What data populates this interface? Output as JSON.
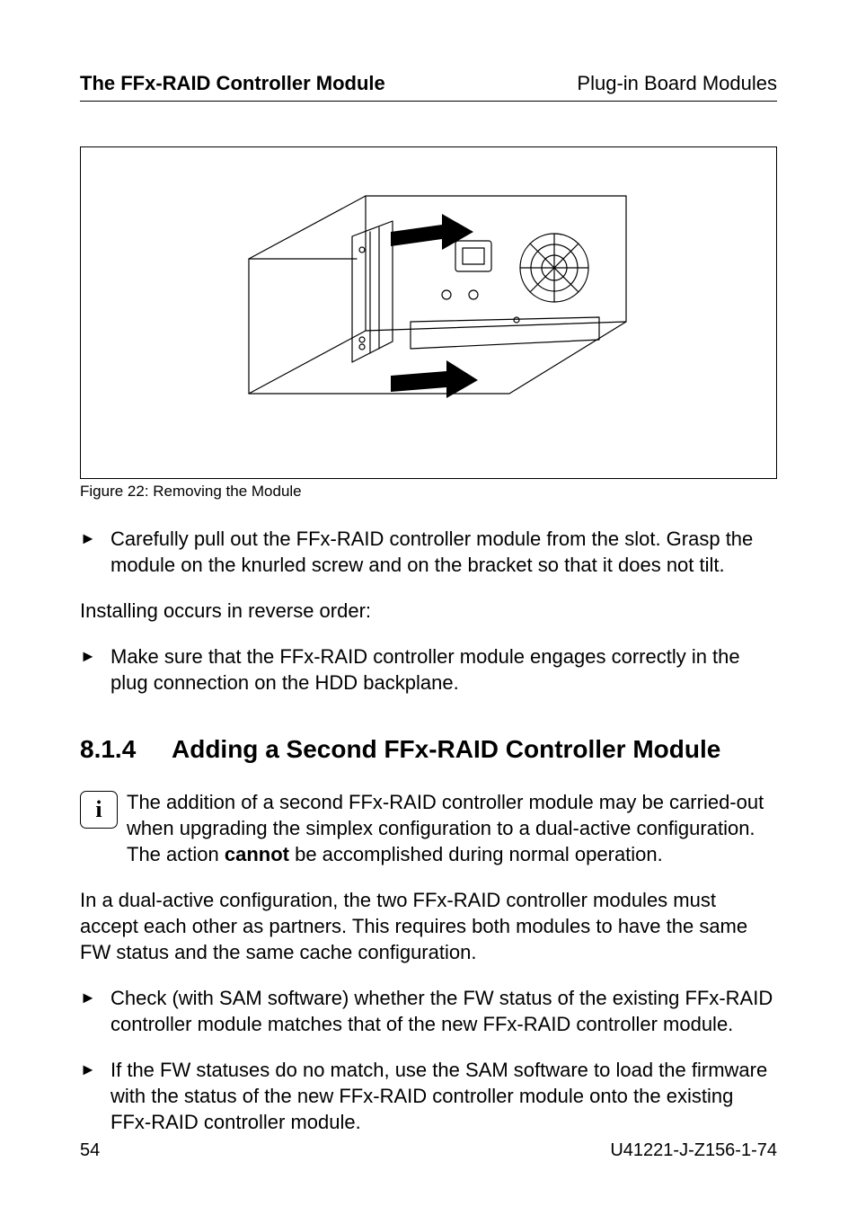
{
  "header": {
    "left": "The FFx-RAID Controller Module",
    "right": "Plug-in Board Modules"
  },
  "figure": {
    "caption": "Figure 22: Removing the Module"
  },
  "instructions": {
    "item1": "Carefully pull out the FFx-RAID controller module from the slot. Grasp the module on the knurled screw and on the bracket so that it does not tilt.",
    "note": "Installing occurs in reverse order:",
    "item2": "Make sure that the FFx-RAID controller module engages correctly in the plug connection on the HDD backplane."
  },
  "section": {
    "number": "8.1.4",
    "title": "Adding a Second FFx-RAID Controller Module"
  },
  "info": {
    "text_a": "The addition of a second FFx-RAID controller module may be carried-out when upgrading the simplex configuration to a dual-active configuration. The action ",
    "text_bold": "cannot",
    "text_b": " be accomplished during normal operation."
  },
  "body": {
    "para1": "In a dual-active configuration, the two FFx-RAID controller modules must accept each other as partners. This requires both modules to have the same FW status and the same cache configuration.",
    "item3": "Check (with SAM software) whether the FW status of the existing FFx-RAID controller module matches that of the new FFx-RAID controller module.",
    "item4": "If the FW statuses do no match, use the SAM software to load the firmware with the status of the new FFx-RAID controller module onto the existing FFx-RAID controller module."
  },
  "footer": {
    "page": "54",
    "docid": "U41221-J-Z156-1-74"
  }
}
